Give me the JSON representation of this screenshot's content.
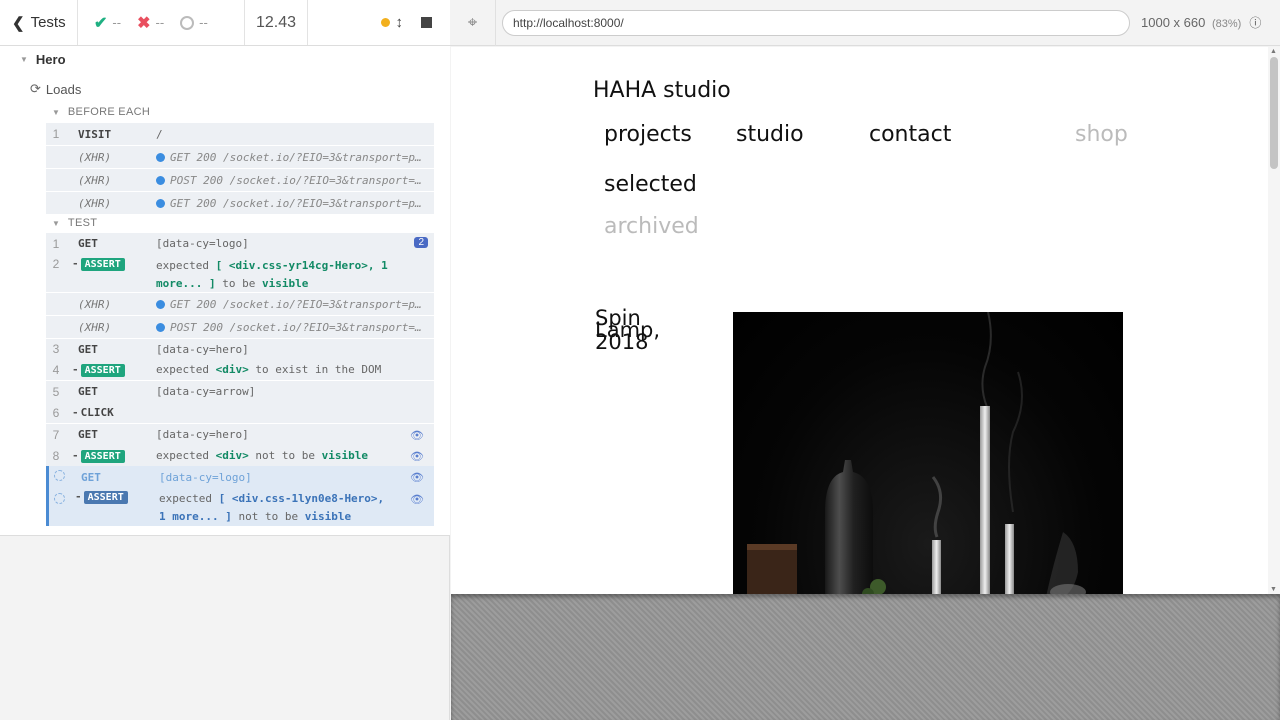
{
  "reporter": {
    "back_label": "Tests",
    "passed": "--",
    "failed": "--",
    "pending": "--",
    "duration": "12.43",
    "suite": "Hero",
    "test": "Loads",
    "before_each_label": "BEFORE EACH",
    "test_label": "TEST",
    "before_each": [
      {
        "num": "1",
        "name": "VISIT",
        "msg": "/"
      },
      {
        "num": "",
        "name": "(XHR)",
        "msg": "GET 200 /socket.io/?EIO=3&transport=polling"
      },
      {
        "num": "",
        "name": "(XHR)",
        "msg": "POST 200 /socket.io/?EIO=3&transport=polling"
      },
      {
        "num": "",
        "name": "(XHR)",
        "msg": "GET 200 /socket.io/?EIO=3&transport=polling"
      }
    ],
    "commands": {
      "c1": {
        "num": "1",
        "name": "GET",
        "msg": "[data-cy=logo]",
        "badge": "2"
      },
      "c2": {
        "num": "2",
        "name": "ASSERT",
        "msg_pre": "expected",
        "msg_subj": "[ <div.css-yr14cg-Hero>, 1",
        "msg_subj2": "more... ]",
        "msg_mid": "to be",
        "msg_end": "visible"
      },
      "x1": {
        "name": "(XHR)",
        "msg": "GET 200 /socket.io/?EIO=3&transport=polling"
      },
      "x2": {
        "name": "(XHR)",
        "msg": "POST 200 /socket.io/?EIO=3&transport=polling"
      },
      "c3": {
        "num": "3",
        "name": "GET",
        "msg": "[data-cy=hero]"
      },
      "c4": {
        "num": "4",
        "name": "ASSERT",
        "msg_pre": "expected",
        "msg_subj": "<div>",
        "msg_mid": "to exist in the DOM"
      },
      "c5": {
        "num": "5",
        "name": "GET",
        "msg": "[data-cy=arrow]"
      },
      "c6": {
        "num": "6",
        "name": "CLICK"
      },
      "c7": {
        "num": "7",
        "name": "GET",
        "msg": "[data-cy=hero]"
      },
      "c8": {
        "num": "8",
        "name": "ASSERT",
        "msg_pre": "expected",
        "msg_subj": "<div>",
        "msg_mid": "not to be",
        "msg_end": "visible"
      },
      "c9": {
        "name": "GET",
        "msg": "[data-cy=logo]"
      },
      "c10": {
        "name": "ASSERT",
        "msg_pre": "expected",
        "msg_subj": "[ <div.css-1lyn0e8-Hero>,",
        "msg_subj2": "1 more... ]",
        "msg_mid": "not to be",
        "msg_end": "visible"
      }
    }
  },
  "aut": {
    "url": "http://localhost:8000/",
    "viewport": "1000 x 660",
    "scale": "(83%)",
    "site": {
      "logo": "HAHA studio",
      "nav": [
        "projects",
        "studio",
        "contact",
        "shop"
      ],
      "sub_nav": [
        "selected",
        "archived"
      ],
      "project_title_1": "Spin",
      "project_title_2": "Lamp,",
      "project_year": "2018"
    }
  }
}
